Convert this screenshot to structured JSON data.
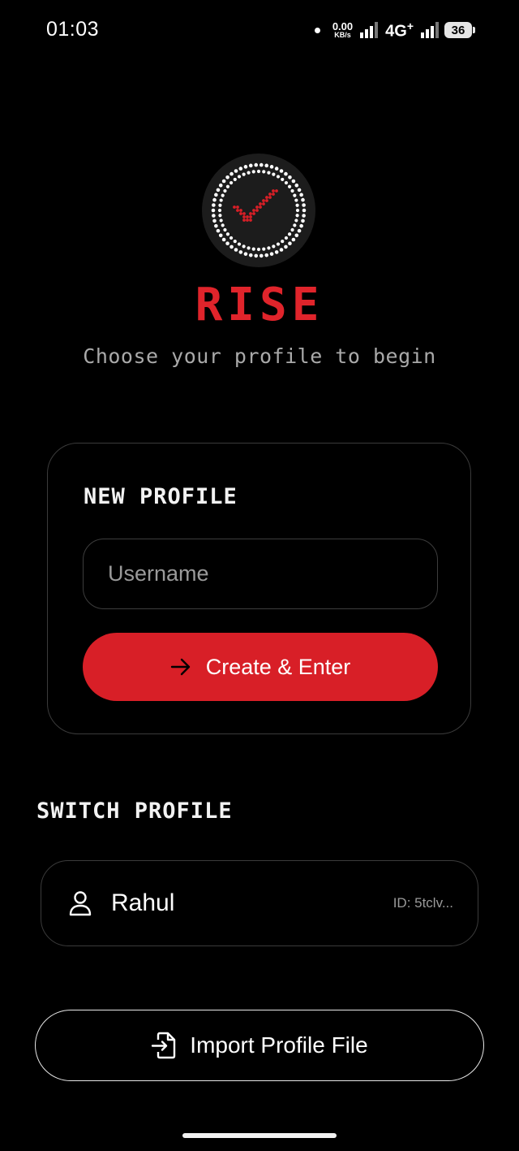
{
  "status_bar": {
    "time": "01:03",
    "net_speed_value": "0.00",
    "net_speed_unit": "KB/s",
    "network_type": "4G",
    "network_suffix": "+",
    "battery": "36"
  },
  "brand": {
    "name": "RISE",
    "tagline": "Choose your profile to begin",
    "accent_color": "#d81f27"
  },
  "new_profile": {
    "title": "NEW PROFILE",
    "username_placeholder": "Username",
    "username_value": "",
    "create_label": "Create & Enter",
    "create_icon": "arrow-right-icon"
  },
  "switch_profile": {
    "title": "SWITCH PROFILE",
    "profiles": [
      {
        "name": "Rahul",
        "id": "ID: 5tclv...",
        "icon": "user-icon"
      }
    ]
  },
  "import": {
    "label": "Import Profile File",
    "icon": "file-import-icon"
  }
}
